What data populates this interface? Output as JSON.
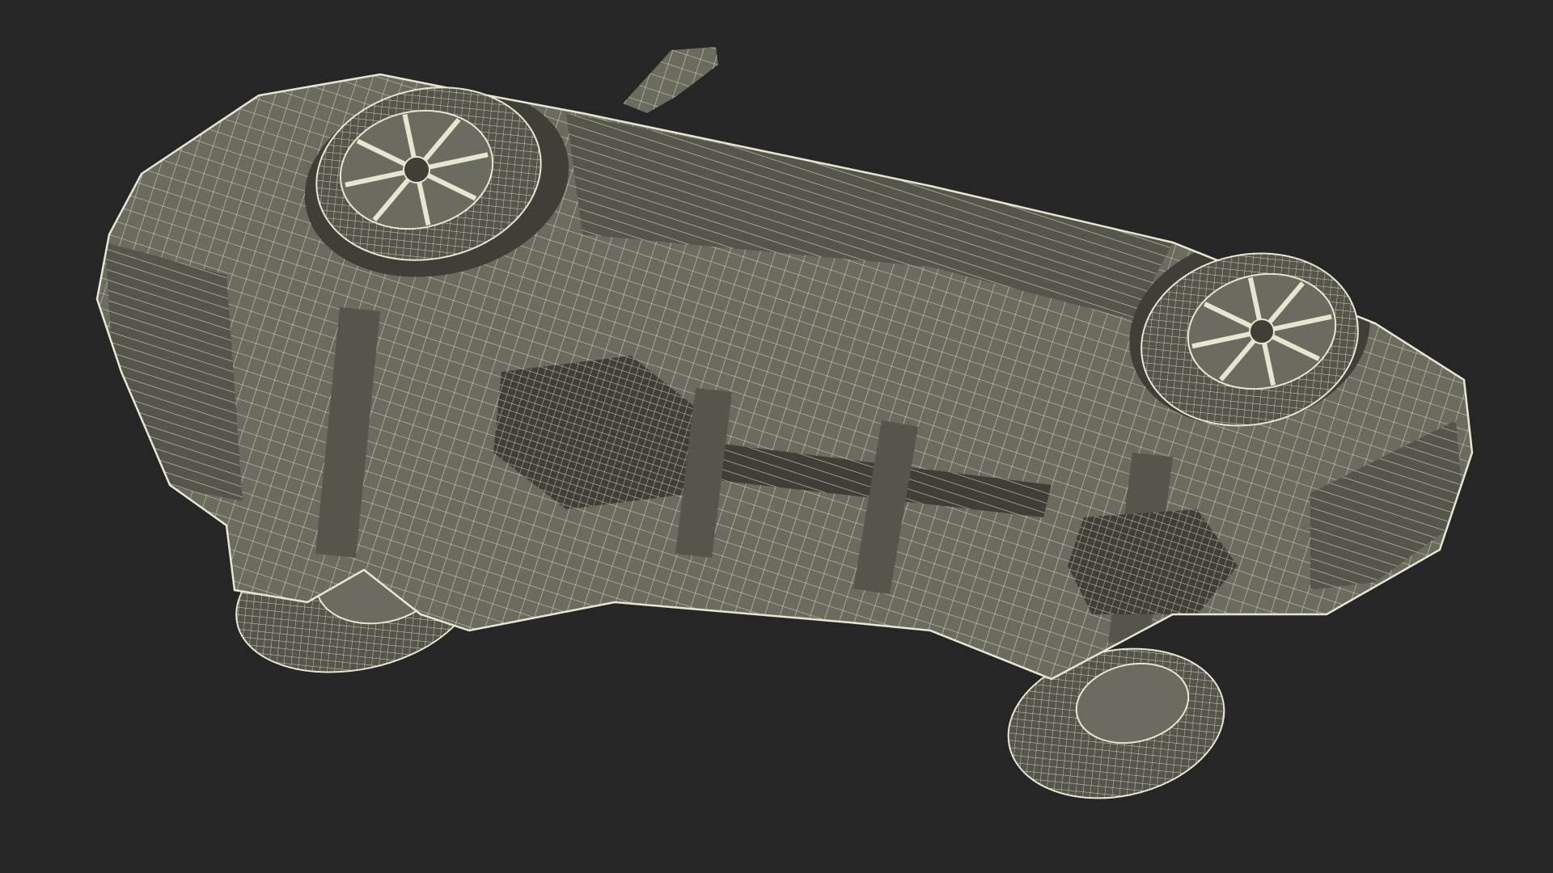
{
  "scene": {
    "subject": "car-underside-wireframe",
    "colors": {
      "background": "#262626",
      "body_fill": "#6b6b5f",
      "body_shade": "#55554b",
      "dark_fill": "#3f3f38",
      "wire": "#e8e6cf",
      "wire_soft": "#c9c7b0"
    },
    "icons": [
      "wireframe-car-body",
      "wheel-front-left",
      "wheel-front-right",
      "wheel-rear-left",
      "wheel-rear-right",
      "side-mirror",
      "fuel-tank",
      "exhaust"
    ]
  }
}
